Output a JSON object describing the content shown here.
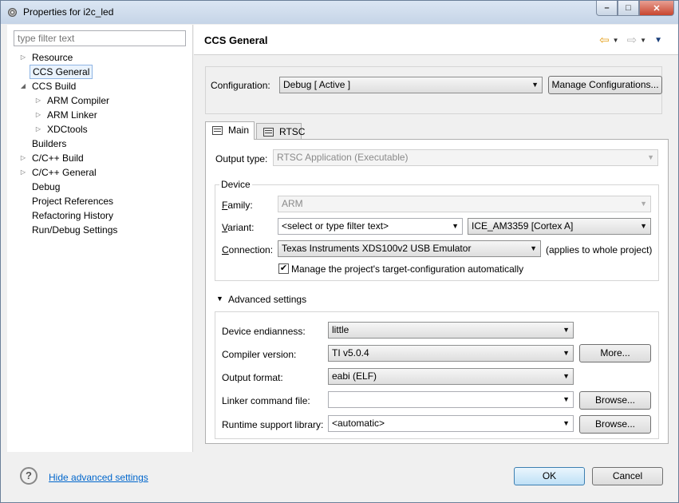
{
  "window": {
    "title": "Properties for i2c_led"
  },
  "filter": {
    "placeholder": "type filter text"
  },
  "tree": {
    "resource": "Resource",
    "ccs_general": "CCS General",
    "ccs_build": "CCS Build",
    "arm_compiler": "ARM Compiler",
    "arm_linker": "ARM Linker",
    "xdctools": "XDCtools",
    "builders": "Builders",
    "cpp_build": "C/C++ Build",
    "cpp_general": "C/C++ General",
    "debug": "Debug",
    "project_references": "Project References",
    "refactoring_history": "Refactoring History",
    "run_debug_settings": "Run/Debug Settings"
  },
  "header": {
    "title": "CCS General"
  },
  "configuration": {
    "label": "Configuration:",
    "value": "Debug  [ Active ]",
    "manage_button": "Manage Configurations..."
  },
  "tabs": {
    "main": "Main",
    "rtsc": "RTSC"
  },
  "output_type": {
    "label": "Output type:",
    "value": "RTSC Application (Executable)"
  },
  "device": {
    "group_title": "Device",
    "family_label_u": "F",
    "family_label_rest": "amily:",
    "family_value": "ARM",
    "variant_label_u": "V",
    "variant_label_rest": "ariant:",
    "variant_filter": "<select or type filter text>",
    "variant_value": "ICE_AM3359 [Cortex A]",
    "connection_label_u": "C",
    "connection_label_rest": "onnection:",
    "connection_value": "Texas Instruments XDS100v2 USB Emulator",
    "connection_note": "(applies to whole project)",
    "manage_check_label": "Manage the project's target-configuration automatically",
    "manage_checked": true
  },
  "advanced": {
    "toggle_label": "Advanced settings",
    "endianness_label": "Device endianness:",
    "endianness_value": "little",
    "compiler_label": "Compiler version:",
    "compiler_value": "TI v5.0.4",
    "more_button": "More...",
    "output_format_label": "Output format:",
    "output_format_value": "eabi (ELF)",
    "linker_cmd_label": "Linker command file:",
    "linker_cmd_value": "",
    "browse_button": "Browse...",
    "rts_label": "Runtime support library:",
    "rts_value": "<automatic>"
  },
  "footer": {
    "help_icon": "?",
    "hide_link": "Hide advanced settings",
    "ok_button": "OK",
    "cancel_button": "Cancel"
  }
}
